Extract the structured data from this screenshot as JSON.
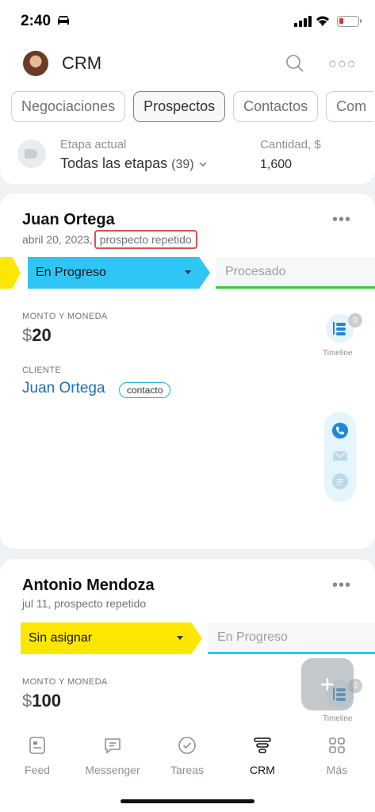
{
  "status": {
    "time": "2:40"
  },
  "header": {
    "title": "CRM"
  },
  "tabs": [
    "Negociaciones",
    "Prospectos",
    "Contactos",
    "Com"
  ],
  "filter": {
    "stage_label": "Etapa actual",
    "stage_value": "Todas las etapas",
    "stage_count": "(39)",
    "qty_label": "Cantidad, $",
    "qty_value": "1,600"
  },
  "cards": [
    {
      "name": "Juan Ortega",
      "date": "abril 20, 2023,",
      "tag": "prospecto repetido",
      "stage_current": "En Progreso",
      "stage_next": "Procesado",
      "amount_label": "MONTO Y MONEDA",
      "currency": "$",
      "amount": "20",
      "timeline_count": "0",
      "timeline_label": "Timeline",
      "client_label": "CLIENTE",
      "client_name": "Juan Ortega",
      "client_badge": "contacto"
    },
    {
      "name": "Antonio Mendoza",
      "subtitle": "jul 11, prospecto repetido",
      "stage_current": "Sin asignar",
      "stage_next": "En Progreso",
      "amount_label": "MONTO Y MONEDA",
      "currency": "$",
      "amount": "100",
      "timeline_count": "0",
      "timeline_label": "Timeline"
    }
  ],
  "fab": "+",
  "nav": [
    "Feed",
    "Messenger",
    "Tareas",
    "CRM",
    "Más"
  ],
  "colors": {
    "yellow_stage": "#fde600",
    "blue_stage": "#2fc6f6",
    "accent_link": "#1f6fb6",
    "progress_green": "#2fd12f"
  }
}
